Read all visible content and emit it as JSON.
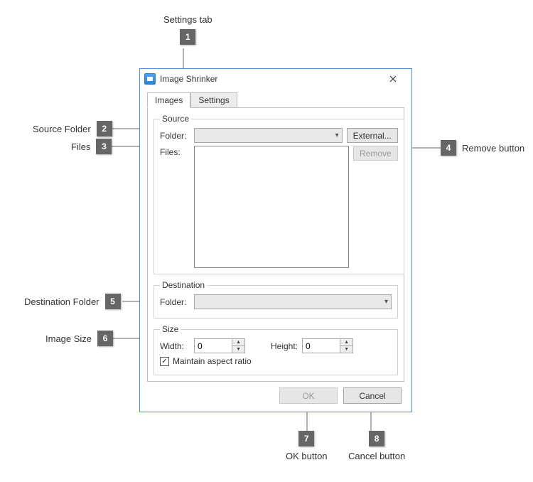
{
  "callouts": {
    "c1": {
      "num": "1",
      "label": "Settings tab"
    },
    "c2": {
      "num": "2",
      "label": "Source Folder"
    },
    "c3": {
      "num": "3",
      "label": "Files"
    },
    "c4": {
      "num": "4",
      "label": "Remove button"
    },
    "c5": {
      "num": "5",
      "label": "Destination Folder"
    },
    "c6": {
      "num": "6",
      "label": "Image Size"
    },
    "c7": {
      "num": "7",
      "label": "OK button"
    },
    "c8": {
      "num": "8",
      "label": "Cancel button"
    }
  },
  "window": {
    "title": "Image Shrinker"
  },
  "tabs": {
    "images": "Images",
    "settings": "Settings"
  },
  "source": {
    "legend": "Source",
    "folder_label": "Folder:",
    "files_label": "Files:",
    "external_btn": "External...",
    "remove_btn": "Remove"
  },
  "destination": {
    "legend": "Destination",
    "folder_label": "Folder:"
  },
  "size": {
    "legend": "Size",
    "width_label": "Width:",
    "height_label": "Height:",
    "width_value": "0",
    "height_value": "0",
    "aspect_label": "Maintain aspect ratio"
  },
  "footer": {
    "ok": "OK",
    "cancel": "Cancel"
  },
  "glyphs": {
    "check": "✓"
  }
}
